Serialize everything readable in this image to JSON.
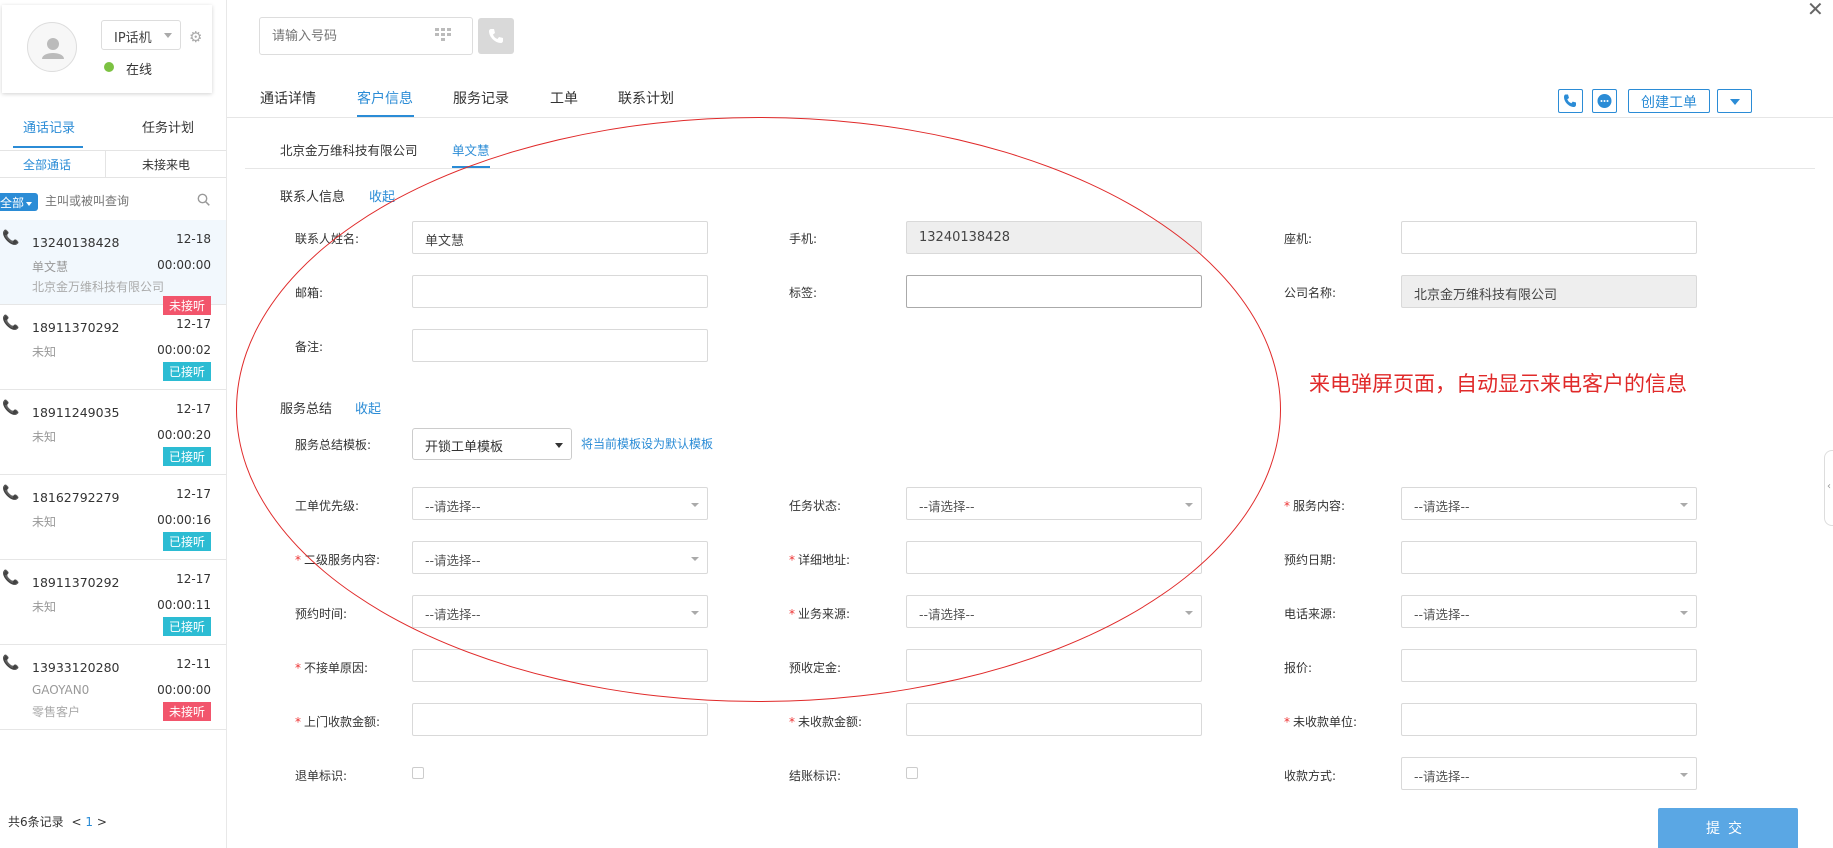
{
  "agent": {
    "mode": "IP话机",
    "status": "在线",
    "status_color": "#7cc242"
  },
  "left_tabs": [
    "通话记录",
    "任务计划"
  ],
  "left_subtabs": [
    "全部通话",
    "未接来电"
  ],
  "filter_label": "全部",
  "search_placeholder": "主叫或被叫查询",
  "calls": [
    {
      "number": "13240138428",
      "date": "12-18",
      "name": "单文慧",
      "duration": "00:00:00",
      "company": "北京金万维科技有限公司",
      "status": "未接听",
      "direction": "out"
    },
    {
      "number": "18911370292",
      "date": "12-17",
      "name": "未知",
      "duration": "00:00:02",
      "company": "",
      "status": "已接听",
      "direction": "in"
    },
    {
      "number": "18911249035",
      "date": "12-17",
      "name": "未知",
      "duration": "00:00:20",
      "company": "",
      "status": "已接听",
      "direction": "in"
    },
    {
      "number": "18162792279",
      "date": "12-17",
      "name": "未知",
      "duration": "00:00:16",
      "company": "",
      "status": "已接听",
      "direction": "in"
    },
    {
      "number": "18911370292",
      "date": "12-17",
      "name": "未知",
      "duration": "00:00:11",
      "company": "",
      "status": "已接听",
      "direction": "in"
    },
    {
      "number": "13933120280",
      "date": "12-11",
      "name": "GAOYAN0",
      "duration": "00:00:00",
      "company": "零售客户",
      "status": "未接听",
      "direction": "out"
    }
  ],
  "pagination": {
    "total": "共6条记录",
    "prev": "<",
    "current": "1",
    "next": ">"
  },
  "dial": {
    "placeholder": "请输入号码"
  },
  "main_tabs": [
    "通话详情",
    "客户信息",
    "服务记录",
    "工单",
    "联系计划"
  ],
  "actions": {
    "create_ticket": "创建工单"
  },
  "sub_tabs": {
    "company": "北京金万维科技有限公司",
    "contact": "单文慧"
  },
  "contact_section": {
    "title": "联系人信息",
    "toggle": "收起",
    "fields": {
      "name_label": "联系人姓名:",
      "name_value": "单文慧",
      "mobile_label": "手机:",
      "mobile_value": "13240138428",
      "phone_label": "座机:",
      "email_label": "邮箱:",
      "tag_label": "标签:",
      "company_label": "公司名称:",
      "company_value": "北京金万维科技有限公司",
      "remark_label": "备注:"
    }
  },
  "service_section": {
    "title": "服务总结",
    "toggle": "收起",
    "template_label": "服务总结模板:",
    "template_value": "开锁工单模板",
    "set_default": "将当前模板设为默认模板",
    "select_placeholder": "--请选择--",
    "labels": {
      "priority": "工单优先级:",
      "task_status": "任务状态:",
      "service_content": "服务内容:",
      "sub_service": "二级服务内容:",
      "address": "详细地址:",
      "appt_date": "预约日期:",
      "appt_time": "预约时间:",
      "source": "业务来源:",
      "phone_source": "电话来源:",
      "reject_reason": "不接单原因:",
      "deposit": "预收定金:",
      "quote": "报价:",
      "onsite_amount": "上门收款金额:",
      "unpaid_amount": "未收款金额:",
      "unpaid_unit": "未收款单位:",
      "refund_flag": "退单标识:",
      "settle_flag": "结账标识:",
      "pay_method": "收款方式:"
    }
  },
  "annotation": "来电弹屏页面，自动显示来电客户的信息",
  "submit": "提交",
  "colors": {
    "accent": "#2b8cd6",
    "missed": "#f2556c",
    "answered": "#2cbcd3",
    "annotation": "#e02a2a"
  }
}
